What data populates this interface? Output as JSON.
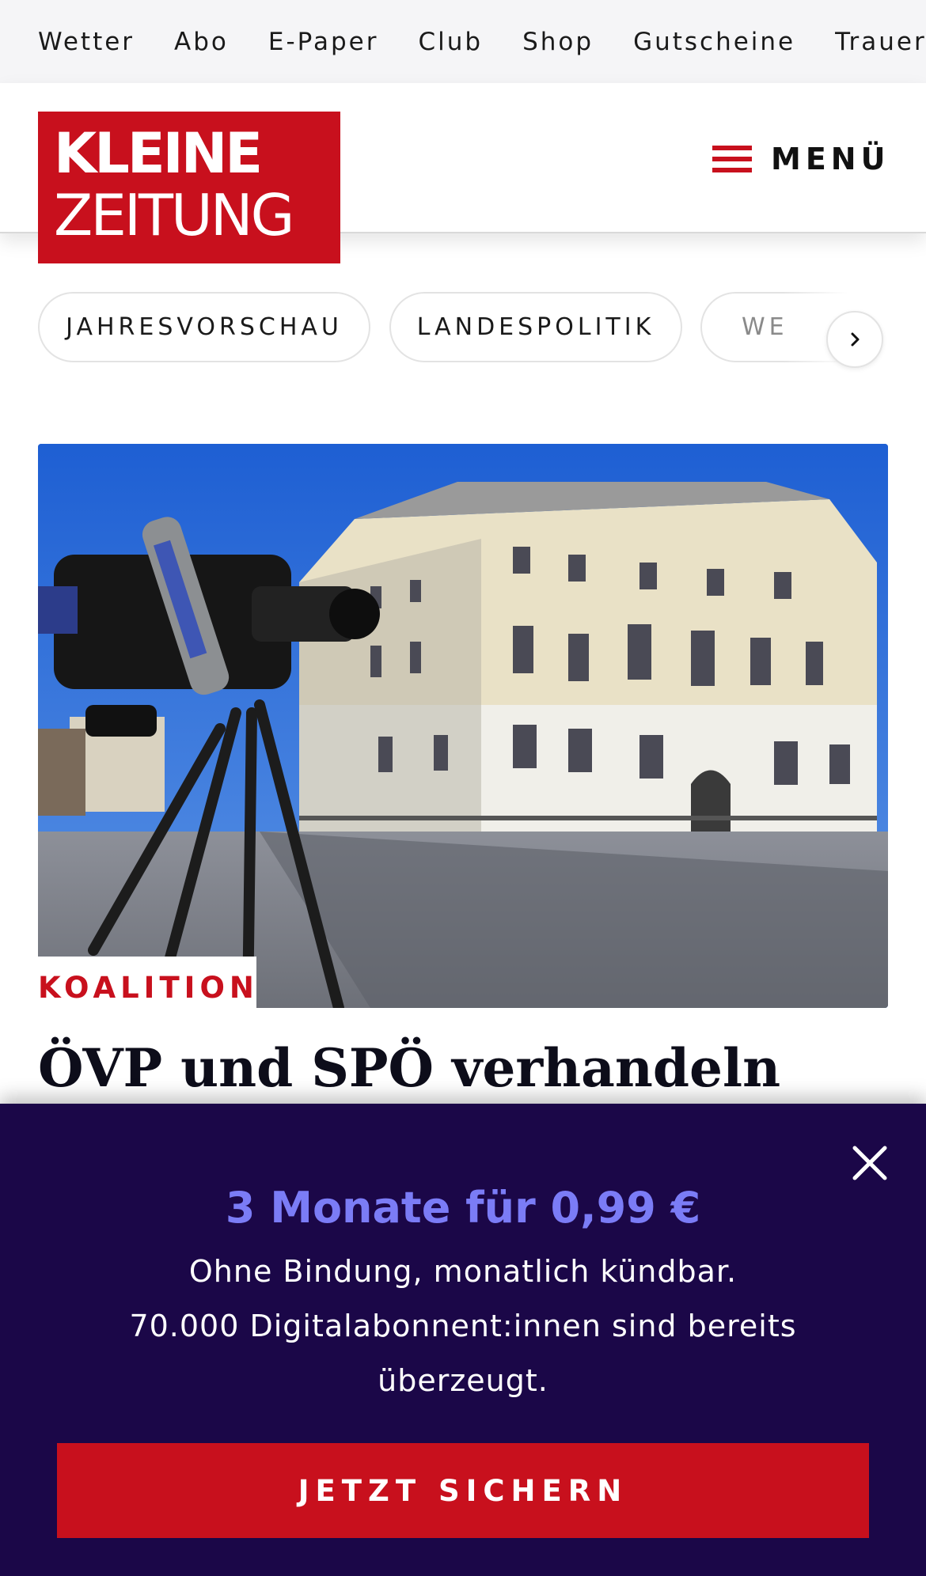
{
  "topnav": {
    "items": [
      "Wetter",
      "Abo",
      "E-Paper",
      "Club",
      "Shop",
      "Gutscheine",
      "Trauerportal"
    ]
  },
  "header": {
    "logo_line1": "KLEINE",
    "logo_line2": "ZEITUNG",
    "menu_label": "MENÜ"
  },
  "topics": {
    "chips": [
      "JAHRESVORSCHAU",
      "LANDESPOLITIK",
      "WE"
    ]
  },
  "article": {
    "kicker": "KOALITION",
    "headline": "ÖVP und SPÖ verhandeln"
  },
  "promo": {
    "title": "3 Monate für 0,99 €",
    "line1": "Ohne Bindung, monatlich kündbar.",
    "line2": "70.000 Digitalabonnent:innen sind bereits",
    "line3": "überzeugt.",
    "cta": "JETZT SICHERN"
  },
  "colors": {
    "brand_red": "#c8101d",
    "promo_bg": "#1b0748",
    "promo_accent": "#7b7cf6"
  }
}
